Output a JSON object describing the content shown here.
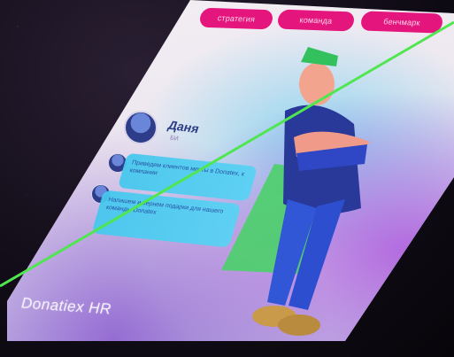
{
  "tabs": [
    "стратегия",
    "команда",
    "бенчмарк"
  ],
  "profile": {
    "name": "Даня",
    "subtitle": "БИ"
  },
  "chat": {
    "messages": [
      "Приведем клиентов мечты в Donatex, к компании",
      "Напишем и вернем подарки для нашего команды Donatex"
    ]
  },
  "brand": "Donatiex HR",
  "colors": {
    "tab_bg": "#e5157e",
    "bubble_bg": "#47c8ee",
    "name_text": "#2b3d86",
    "guide_line": "#4fe64f"
  },
  "icons": [
    "avatar-icon",
    "superhero-illustration"
  ]
}
